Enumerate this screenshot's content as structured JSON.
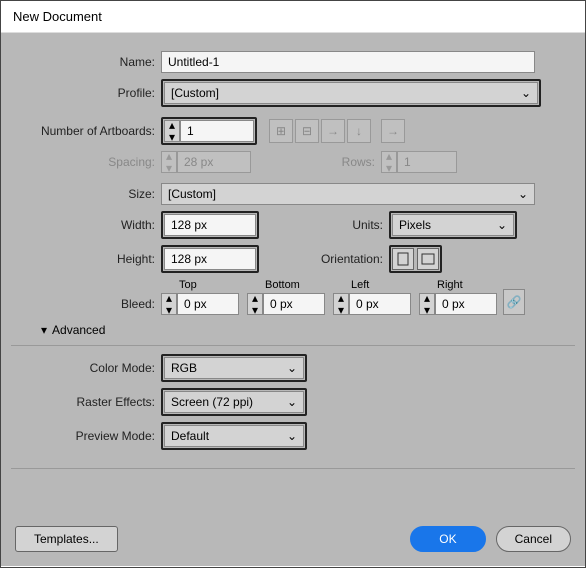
{
  "title": "New Document",
  "labels": {
    "name": "Name:",
    "profile": "Profile:",
    "numArtboards": "Number of Artboards:",
    "spacing": "Spacing:",
    "rows": "Rows:",
    "size": "Size:",
    "width": "Width:",
    "height": "Height:",
    "units": "Units:",
    "orientation": "Orientation:",
    "bleed": "Bleed:",
    "top": "Top",
    "bottom": "Bottom",
    "left": "Left",
    "right": "Right",
    "advanced": "Advanced",
    "colorMode": "Color Mode:",
    "rasterEffects": "Raster Effects:",
    "previewMode": "Preview Mode:"
  },
  "values": {
    "name": "Untitled-1",
    "profile": "[Custom]",
    "numArtboards": "1",
    "spacing": "28 px",
    "rows": "1",
    "size": "[Custom]",
    "width": "128 px",
    "height": "128 px",
    "units": "Pixels",
    "bleedTop": "0 px",
    "bleedBottom": "0 px",
    "bleedLeft": "0 px",
    "bleedRight": "0 px",
    "colorMode": "RGB",
    "rasterEffects": "Screen (72 ppi)",
    "previewMode": "Default"
  },
  "buttons": {
    "templates": "Templates...",
    "ok": "OK",
    "cancel": "Cancel"
  }
}
